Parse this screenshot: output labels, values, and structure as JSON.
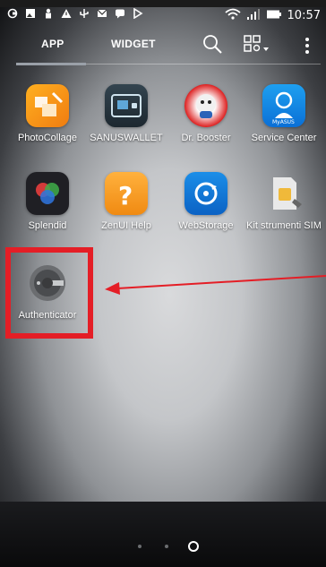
{
  "status_bar": {
    "time": "10:57"
  },
  "tabs": [
    {
      "label": "APP"
    },
    {
      "label": "WIDGET"
    }
  ],
  "apps": [
    {
      "name": "PhotoCollage"
    },
    {
      "name": "SANUSWALLET"
    },
    {
      "name": "Dr. Booster"
    },
    {
      "name": "Service Center"
    },
    {
      "name": "Splendid"
    },
    {
      "name": "ZenUI Help"
    },
    {
      "name": "WebStorage"
    },
    {
      "name": "Kit strumenti SIM"
    },
    {
      "name": "Authenticator"
    }
  ],
  "annotation": {
    "highlight_color": "#e41e26"
  },
  "colors": {
    "accent_red": "#e41e26",
    "text": "#ffffff"
  }
}
